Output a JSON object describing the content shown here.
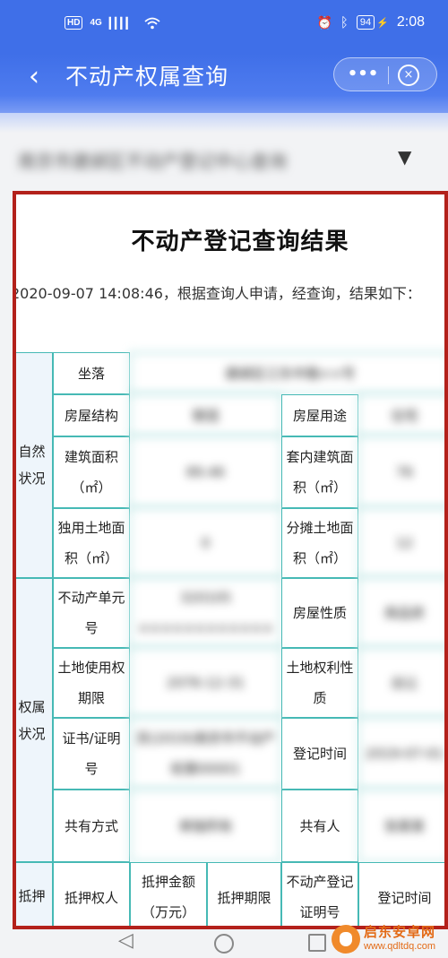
{
  "status_bar": {
    "hd": "HD",
    "network": "4G",
    "signal": "▎▎▎▎",
    "wifi_icon": "wifi-icon",
    "alarm": "⏰",
    "bluetooth": "ᛒ",
    "battery": "94",
    "charge": "⚡",
    "time": "2:08"
  },
  "title_bar": {
    "back": "‹",
    "title": "不动产权属查询",
    "more": "•••",
    "close": "×"
  },
  "selector": {
    "value": "南京市建邺区不动产登记中心查询",
    "arrow": "▼"
  },
  "result": {
    "title": "不动产登记查询结果",
    "description": "2020-09-07 14:08:46，根据查询人申请，经查询，结果如下：",
    "groups": {
      "natural": "自然状况",
      "rights": "权属状况",
      "mortgage": "抵押"
    },
    "labels": {
      "location": "坐落",
      "structure": "房屋结构",
      "usage": "房屋用途",
      "area": "建筑面积（㎡）",
      "inner_area": "套内建筑面积（㎡）",
      "exclusive_land": "独用土地面积（㎡）",
      "shared_land": "分摊土地面积（㎡）",
      "unit_no": "不动产单元号",
      "house_nature": "房屋性质",
      "land_term": "土地使用权期限",
      "land_nature": "土地权利性质",
      "cert_no": "证书/证明号",
      "reg_time": "登记时间",
      "co_owner_type": "共有方式",
      "co_owner": "共有人",
      "mortgagee": "抵押权人",
      "mortgage_amount": "抵押金额（万元）",
      "mortgage_term": "抵押期限",
      "mortgage_cert": "不动产登记证明号",
      "mortgage_reg_time": "登记时间"
    },
    "values": {
      "location": "建邺区江东中路××号",
      "structure": "钢混",
      "usage": "住宅",
      "area": "89.46",
      "inner_area": "76",
      "exclusive_land": "0",
      "shared_land": "12",
      "unit_no": "320105 ××××××××××××",
      "house_nature": "商品房",
      "land_term": "2076-12-31",
      "land_nature": "出让",
      "cert_no": "苏(2019)南京市不动产权第00001",
      "reg_time": "2019-07-01",
      "co_owner_type": "单独所有",
      "co_owner": "张某某"
    }
  },
  "nav_bar": {
    "back": "◁"
  },
  "watermark": {
    "name": "启东安卓网",
    "url": "www.qdltdq.com"
  }
}
